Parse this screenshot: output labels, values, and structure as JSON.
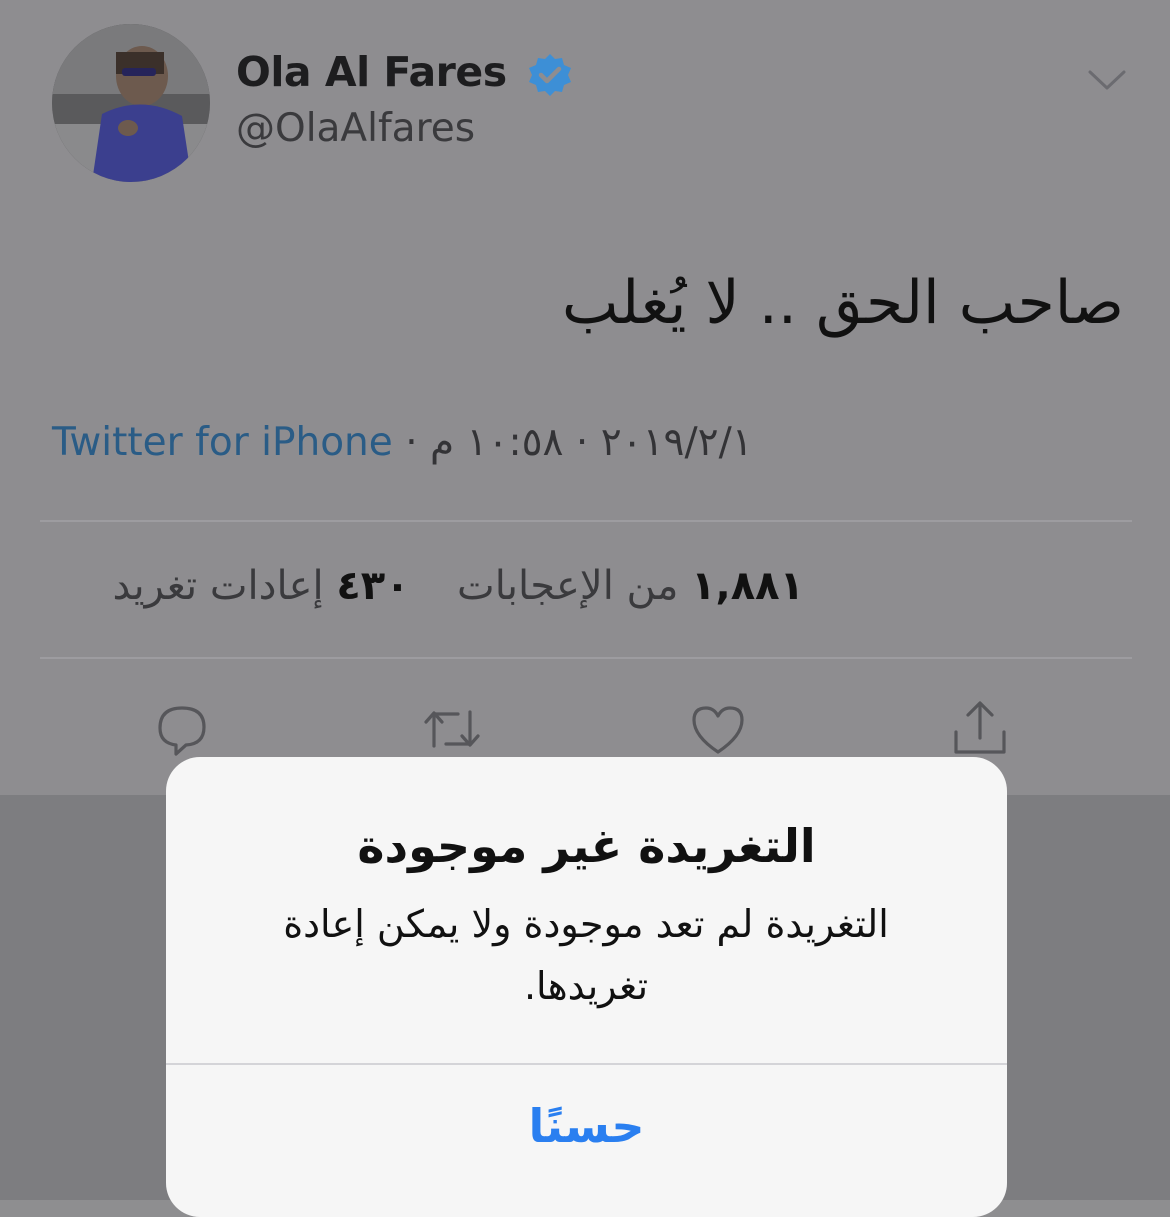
{
  "tweet": {
    "author_name": "Ola Al Fares",
    "author_handle": "@OlaAlfares",
    "text": "صاحب الحق .. لا يُغلب",
    "time": "١٠:٥٨ م",
    "date": "٢٠١٩/٢/١",
    "source": "Twitter for iPhone",
    "dot_separator": "·",
    "likes_count": "١,٨٨١",
    "likes_label": "من الإعجابات",
    "retweets_count": "٤٣٠",
    "retweets_label": "إعادات تغريد"
  },
  "icons": {
    "verified": "verified-badge-icon",
    "more": "chevron-down-icon",
    "reply": "reply-icon",
    "retweet": "retweet-icon",
    "like": "heart-icon",
    "share": "share-icon"
  },
  "alert": {
    "title": "التغريدة غير موجودة",
    "message": "التغريدة لم تعد موجودة ولا يمكن إعادة تغريدها.",
    "ok_button": "حسنًا"
  },
  "colors": {
    "accent": "#2a7ff0",
    "verified": "#3d8fd6",
    "source_link": "#2a5c86",
    "overlay_background": "#8e8d90"
  }
}
